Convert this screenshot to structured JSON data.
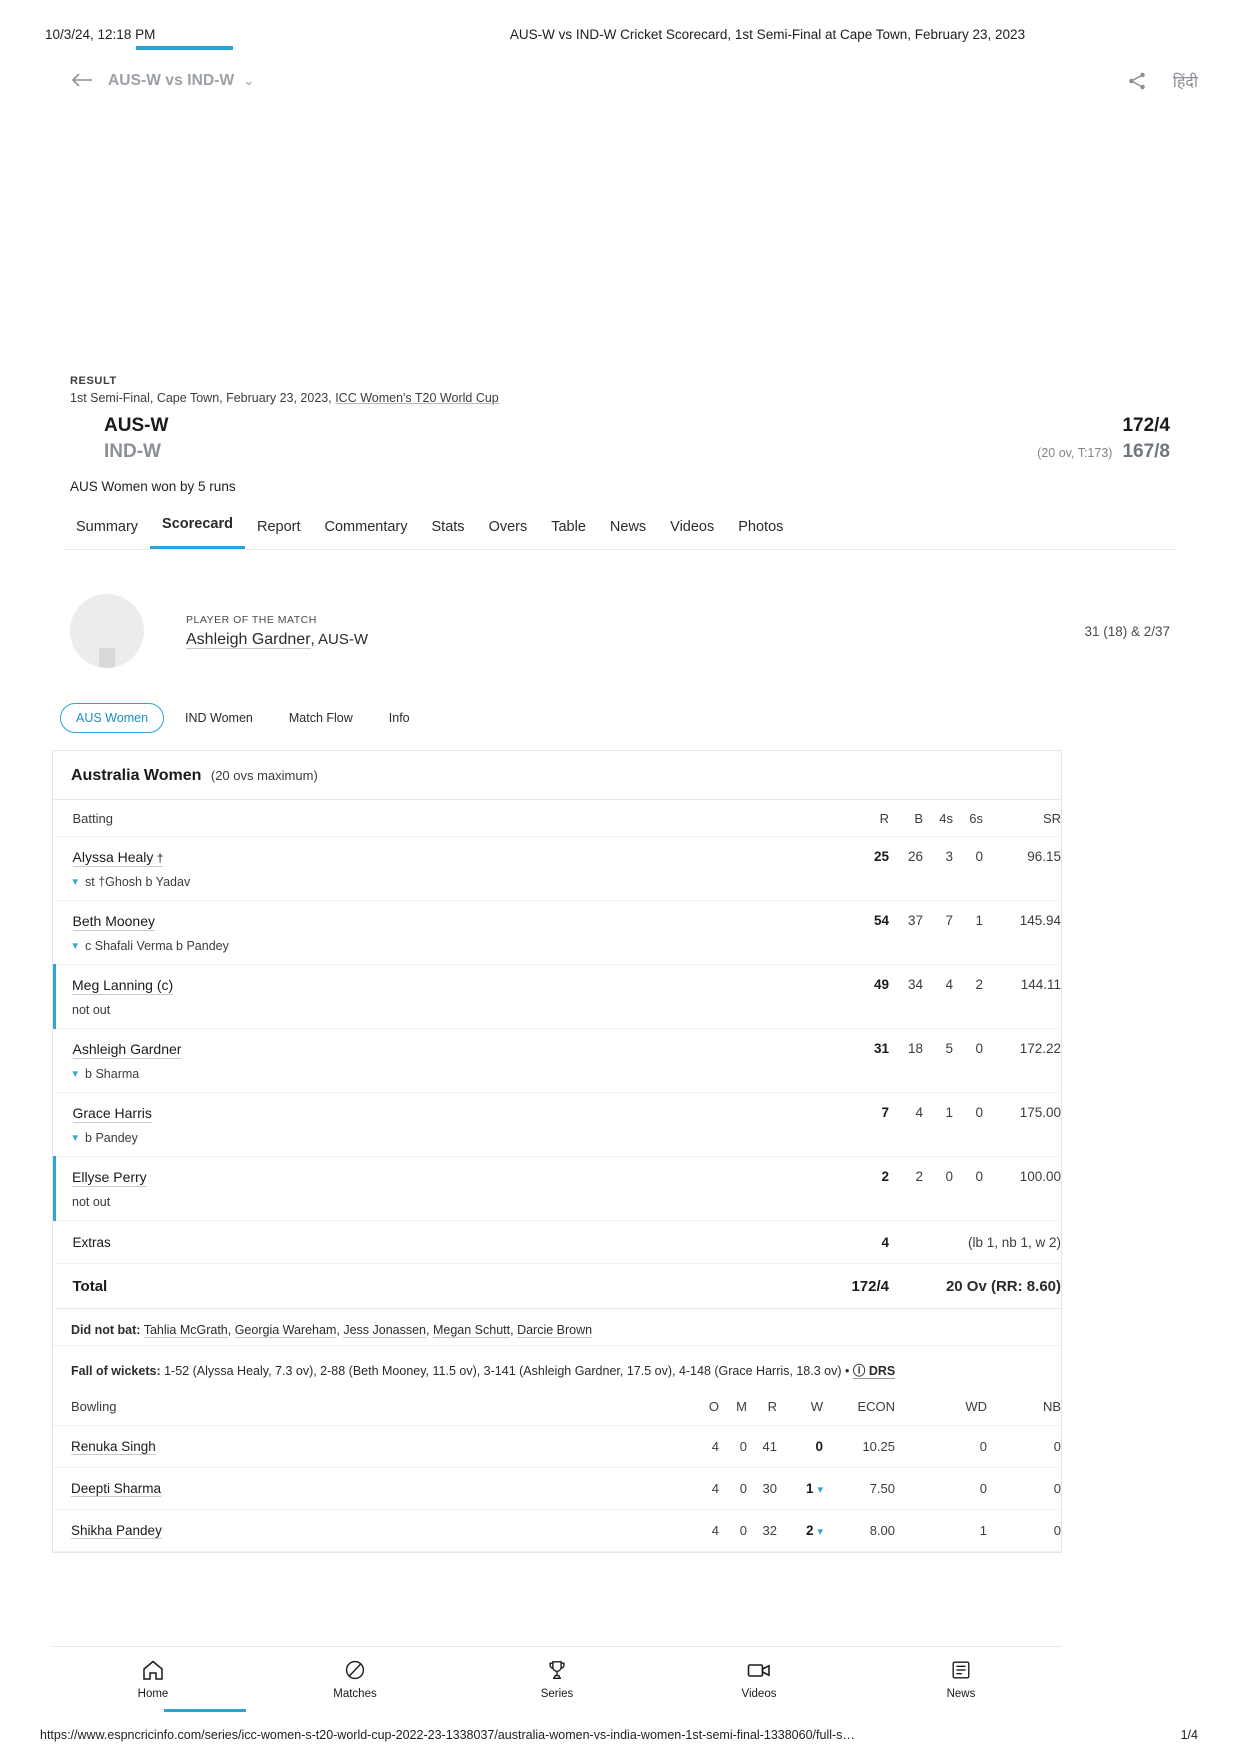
{
  "print": {
    "date": "10/3/24, 12:18 PM",
    "title": "AUS-W vs IND-W Cricket Scorecard, 1st Semi-Final at Cape Town, February 23, 2023",
    "url": "https://www.espncricinfo.com/series/icc-women-s-t20-world-cup-2022-23-1338037/australia-women-vs-india-women-1st-semi-final-1338060/full-s…",
    "page": "1/4"
  },
  "appbar": {
    "title": "AUS-W vs IND-W",
    "caret": "⌄",
    "hindi_label": "हिंदी"
  },
  "result": {
    "label": "RESULT",
    "meta_prefix": "1st Semi-Final, Cape Town, February 23, 2023, ",
    "series_link": "ICC Women's T20 World Cup",
    "teams": [
      {
        "name": "AUS-W",
        "overs": "",
        "score": "172/4",
        "dim": false
      },
      {
        "name": "IND-W",
        "overs": "(20 ov, T:173)",
        "score": "167/8",
        "dim": true
      }
    ],
    "outcome": "AUS Women won by 5 runs"
  },
  "nav_tabs": [
    {
      "label": "Summary",
      "active": false
    },
    {
      "label": "Scorecard",
      "active": true
    },
    {
      "label": "Report",
      "active": false
    },
    {
      "label": "Commentary",
      "active": false
    },
    {
      "label": "Stats",
      "active": false
    },
    {
      "label": "Overs",
      "active": false
    },
    {
      "label": "Table",
      "active": false
    },
    {
      "label": "News",
      "active": false
    },
    {
      "label": "Videos",
      "active": false
    },
    {
      "label": "Photos",
      "active": false
    }
  ],
  "potm": {
    "label": "PLAYER OF THE MATCH",
    "name": "Ashleigh Gardner",
    "team": ", AUS-W",
    "figures": "31 (18) & 2/37"
  },
  "pill_tabs": [
    {
      "label": "AUS Women",
      "active": true
    },
    {
      "label": "IND Women",
      "active": false
    },
    {
      "label": "Match Flow",
      "active": false
    },
    {
      "label": "Info",
      "active": false
    }
  ],
  "innings": {
    "team": "Australia Women",
    "overs_max": "(20 ovs maximum)",
    "batting_headers": {
      "name": "Batting",
      "r": "R",
      "b": "B",
      "fours": "4s",
      "sixes": "6s",
      "sr": "SR"
    },
    "batters": [
      {
        "name": "Alyssa Healy",
        "suffix": " †",
        "dismissal": "st †Ghosh b Yadav",
        "out": true,
        "live": false,
        "r": "25",
        "b": "26",
        "fours": "3",
        "sixes": "0",
        "sr": "96.15"
      },
      {
        "name": "Beth Mooney",
        "suffix": "",
        "dismissal": "c Shafali Verma b Pandey",
        "out": true,
        "live": false,
        "r": "54",
        "b": "37",
        "fours": "7",
        "sixes": "1",
        "sr": "145.94"
      },
      {
        "name": "Meg Lanning (c)",
        "suffix": "",
        "dismissal": "not out",
        "out": false,
        "live": true,
        "r": "49",
        "b": "34",
        "fours": "4",
        "sixes": "2",
        "sr": "144.11"
      },
      {
        "name": "Ashleigh Gardner",
        "suffix": "",
        "dismissal": "b Sharma",
        "out": true,
        "live": false,
        "r": "31",
        "b": "18",
        "fours": "5",
        "sixes": "0",
        "sr": "172.22"
      },
      {
        "name": "Grace Harris",
        "suffix": "",
        "dismissal": "b Pandey",
        "out": true,
        "live": false,
        "r": "7",
        "b": "4",
        "fours": "1",
        "sixes": "0",
        "sr": "175.00"
      },
      {
        "name": "Ellyse Perry",
        "suffix": "",
        "dismissal": "not out",
        "out": false,
        "live": true,
        "r": "2",
        "b": "2",
        "fours": "0",
        "sixes": "0",
        "sr": "100.00"
      }
    ],
    "extras": {
      "label": "Extras",
      "value": "4",
      "note": "(lb 1, nb 1, w 2)"
    },
    "total": {
      "label": "Total",
      "value": "172/4",
      "detail": "20 Ov (RR: 8.60)"
    },
    "did_not_bat": {
      "label": "Did not bat:",
      "players": [
        "Tahlia McGrath",
        "Georgia Wareham",
        "Jess Jonassen",
        "Megan Schutt",
        "Darcie Brown"
      ]
    },
    "fall_of_wickets": {
      "label": "Fall of wickets:",
      "text": "1-52 (Alyssa Healy, 7.3 ov), 2-88 (Beth Mooney, 11.5 ov), 3-141 (Ashleigh Gardner, 17.5 ov), 4-148 (Grace Harris, 18.3 ov)",
      "separator": " • ",
      "drs": "DRS"
    },
    "bowling_headers": {
      "name": "Bowling",
      "o": "O",
      "m": "M",
      "r": "R",
      "w": "W",
      "econ": "ECON",
      "wd": "WD",
      "nb": "NB"
    },
    "bowlers": [
      {
        "name": "Renuka Singh",
        "o": "4",
        "m": "0",
        "r": "41",
        "w": "0",
        "expandable": false,
        "econ": "10.25",
        "wd": "0",
        "nb": "0"
      },
      {
        "name": "Deepti Sharma",
        "o": "4",
        "m": "0",
        "r": "30",
        "w": "1",
        "expandable": true,
        "econ": "7.50",
        "wd": "0",
        "nb": "0"
      },
      {
        "name": "Shikha Pandey",
        "o": "4",
        "m": "0",
        "r": "32",
        "w": "2",
        "expandable": true,
        "econ": "8.00",
        "wd": "1",
        "nb": "0"
      }
    ]
  },
  "bottom_nav": [
    {
      "label": "Home",
      "icon": "home-icon",
      "active": true
    },
    {
      "label": "Matches",
      "icon": "ball-icon",
      "active": false
    },
    {
      "label": "Series",
      "icon": "trophy-icon",
      "active": false
    },
    {
      "label": "Videos",
      "icon": "video-icon",
      "active": false
    },
    {
      "label": "News",
      "icon": "news-icon",
      "active": false
    }
  ],
  "colors": {
    "accent": "#2aa3d6",
    "chevron": "#36a3cf"
  }
}
